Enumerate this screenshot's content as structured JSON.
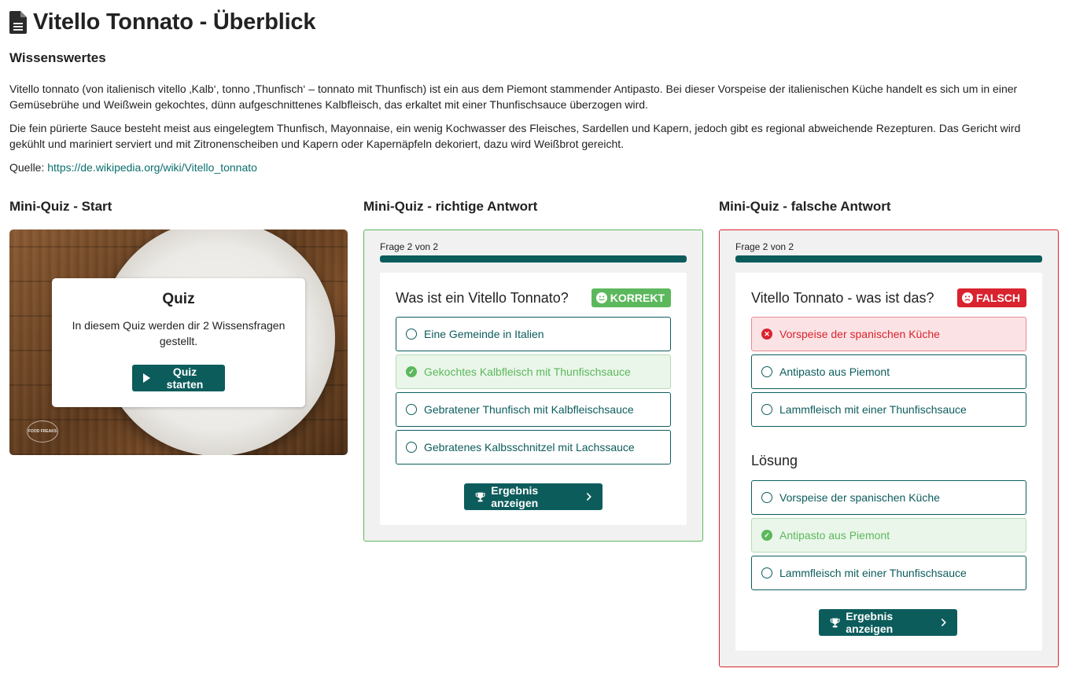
{
  "header": {
    "title": "Vitello Tonnato - Überblick",
    "icon": "document-icon"
  },
  "info": {
    "heading": "Wissenswertes",
    "paragraph1": "Vitello tonnato (von italienisch vitello ‚Kalb‘, tonno ‚Thunfisch‘ – tonnato mit Thunfisch) ist ein aus dem Piemont stammender Antipasto. Bei dieser Vorspeise der italienischen Küche handelt es sich um in einer Gemüsebrühe und Weißwein gekochtes, dünn aufgeschnittenes Kalbfleisch, das erkaltet mit einer Thunfischsauce überzogen wird.",
    "paragraph2": "Die fein pürierte Sauce besteht meist aus eingelegtem Thunfisch, Mayonnaise, ein wenig Kochwasser des Fleisches, Sardellen und Kapern, jedoch gibt es regional abweichende Rezepturen. Das Gericht wird gekühlt und mariniert serviert und mit Zitronenscheiben und Kapern oder Kapernäpfeln dekoriert, dazu wird Weißbrot gereicht.",
    "source_label": "Quelle:",
    "source_link": "https://de.wikipedia.org/wiki/Vitello_tonnato"
  },
  "columns": {
    "start_title": "Mini-Quiz - Start",
    "correct_title": "Mini-Quiz - richtige Antwort",
    "wrong_title": "Mini-Quiz - falsche Antwort"
  },
  "start_card": {
    "heading": "Quiz",
    "description": "In diesem Quiz werden dir 2 Wissensfragen gestellt.",
    "start_button": "Quiz starten",
    "logo_text": "FOOD FREAKS",
    "colors": {
      "button": "#0d5c5c"
    }
  },
  "quiz_correct": {
    "progress_label": "Frage 2 von 2",
    "progress_fraction": 1.0,
    "question": "Was ist ein Vitello Tonnato?",
    "status": "KORREKT",
    "options": [
      {
        "label": "Eine Gemeinde in Italien",
        "state": "neutral"
      },
      {
        "label": "Gekochtes Kalbfleisch mit Thunfischsauce",
        "state": "correct"
      },
      {
        "label": "Gebratener Thunfisch mit Kalbfleischsauce",
        "state": "neutral"
      },
      {
        "label": "Gebratenes Kalbsschnitzel mit Lachssauce",
        "state": "neutral"
      }
    ],
    "result_button": "Ergebnis anzeigen"
  },
  "quiz_wrong": {
    "progress_label": "Frage 2 von 2",
    "progress_fraction": 1.0,
    "question": "Vitello Tonnato - was ist das?",
    "status": "FALSCH",
    "options": [
      {
        "label": "Vorspeise der spanischen Küche",
        "state": "wrong"
      },
      {
        "label": "Antipasto aus Piemont",
        "state": "neutral"
      },
      {
        "label": "Lammfleisch mit einer Thunfischsauce",
        "state": "neutral"
      }
    ],
    "solution_heading": "Lösung",
    "solution_options": [
      {
        "label": "Vorspeise der spanischen Küche",
        "state": "neutral"
      },
      {
        "label": "Antipasto aus Piemont",
        "state": "correct"
      },
      {
        "label": "Lammfleisch mit einer Thunfischsauce",
        "state": "neutral"
      }
    ],
    "result_button": "Ergebnis anzeigen"
  },
  "colors": {
    "primary": "#0d5c5c",
    "success": "#5cb85c",
    "danger": "#d9232e"
  }
}
